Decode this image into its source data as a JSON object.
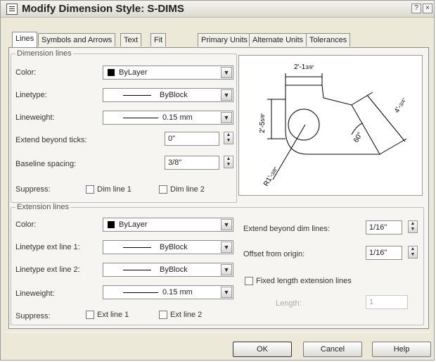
{
  "window": {
    "title": "Modify Dimension Style: S-DIMS",
    "help_btn": "?",
    "close_btn": "×"
  },
  "tabs": [
    "Lines",
    "Symbols and Arrows",
    "Text",
    "Fit",
    "Primary Units",
    "Alternate Units",
    "Tolerances"
  ],
  "dimension_lines": {
    "group_title": "Dimension lines",
    "color_label": "Color:",
    "color_value": "ByLayer",
    "linetype_label": "Linetype:",
    "linetype_value": "ByBlock",
    "lineweight_label": "Lineweight:",
    "lineweight_value": "0.15 mm",
    "extend_ticks_label": "Extend beyond ticks:",
    "extend_ticks_value": "0\"",
    "baseline_label": "Baseline spacing:",
    "baseline_value": "3/8\"",
    "suppress_label": "Suppress:",
    "dim_line1": "Dim line 1",
    "dim_line2": "Dim line 2"
  },
  "extension_lines": {
    "group_title": "Extension lines",
    "color_label": "Color:",
    "color_value": "ByLayer",
    "lt1_label": "Linetype ext line 1:",
    "lt1_value": "ByBlock",
    "lt2_label": "Linetype ext line 2:",
    "lt2_value": "ByBlock",
    "lineweight_label": "Lineweight:",
    "lineweight_value": "0.15 mm",
    "suppress_label": "Suppress:",
    "ext_line1": "Ext line 1",
    "ext_line2": "Ext line 2",
    "extend_dim_label": "Extend beyond dim lines:",
    "extend_dim_value": "1/16\"",
    "offset_label": "Offset from origin:",
    "offset_value": "1/16\"",
    "fixed_length_label": "Fixed length extension lines",
    "length_label": "Length:",
    "length_value": "1"
  },
  "preview": {
    "dim_top": "2'-1",
    "dim_top_frac": "3/8\"",
    "dim_left": "2'-5",
    "dim_left_frac": "5/8\"",
    "dim_right": "4'-",
    "dim_right_frac": "3/4\"",
    "dim_angle": "60°",
    "dim_radius": "R1'-",
    "dim_radius_frac": "3/8\""
  },
  "buttons": {
    "ok": "OK",
    "cancel": "Cancel",
    "help": "Help"
  }
}
